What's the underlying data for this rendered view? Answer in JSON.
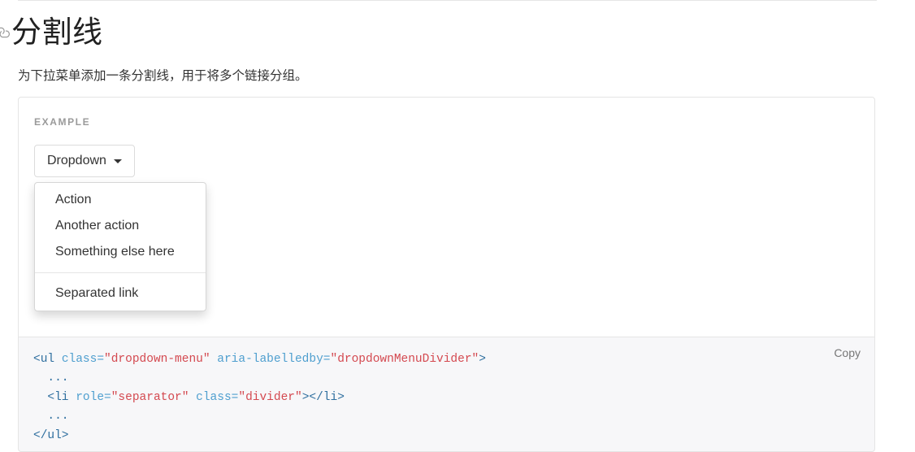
{
  "page": {
    "title": "分割线",
    "description": "为下拉菜单添加一条分割线，用于将多个链接分组。",
    "anchor_icon": "link-anchor-icon"
  },
  "example": {
    "label": "EXAMPLE",
    "dropdown_button": {
      "label": "Dropdown",
      "caret_icon": "caret-down-icon"
    },
    "menu_items": [
      {
        "label": "Action",
        "type": "item"
      },
      {
        "label": "Another action",
        "type": "item"
      },
      {
        "label": "Something else here",
        "type": "item"
      },
      {
        "label": "",
        "type": "divider"
      },
      {
        "label": "Separated link",
        "type": "item"
      }
    ]
  },
  "code": {
    "copy_label": "Copy",
    "language": "html",
    "lines": [
      [
        {
          "text": "<ul ",
          "token": "tag"
        },
        {
          "text": "class=",
          "token": "attr"
        },
        {
          "text": "\"dropdown-menu\"",
          "token": "val"
        },
        {
          "text": " ",
          "token": "plain"
        },
        {
          "text": "aria-labelledby=",
          "token": "attr"
        },
        {
          "text": "\"dropdownMenuDivider\"",
          "token": "val"
        },
        {
          "text": ">",
          "token": "tag"
        }
      ],
      [
        {
          "text": "  ...",
          "token": "tag"
        }
      ],
      [
        {
          "text": "  <li ",
          "token": "tag"
        },
        {
          "text": "role=",
          "token": "attr"
        },
        {
          "text": "\"separator\"",
          "token": "val"
        },
        {
          "text": " ",
          "token": "plain"
        },
        {
          "text": "class=",
          "token": "attr"
        },
        {
          "text": "\"divider\"",
          "token": "val"
        },
        {
          "text": "></li>",
          "token": "tag"
        }
      ],
      [
        {
          "text": "  ...",
          "token": "tag"
        }
      ],
      [
        {
          "text": "</ul>",
          "token": "tag"
        }
      ]
    ]
  },
  "colors": {
    "panel_border": "#e5e5e5",
    "code_background": "#f7f7f9",
    "tag": "#2f6f9f",
    "attribute": "#4f9fcf",
    "value": "#d44950",
    "muted_text": "#9a9a9a",
    "body_text": "#333333"
  }
}
